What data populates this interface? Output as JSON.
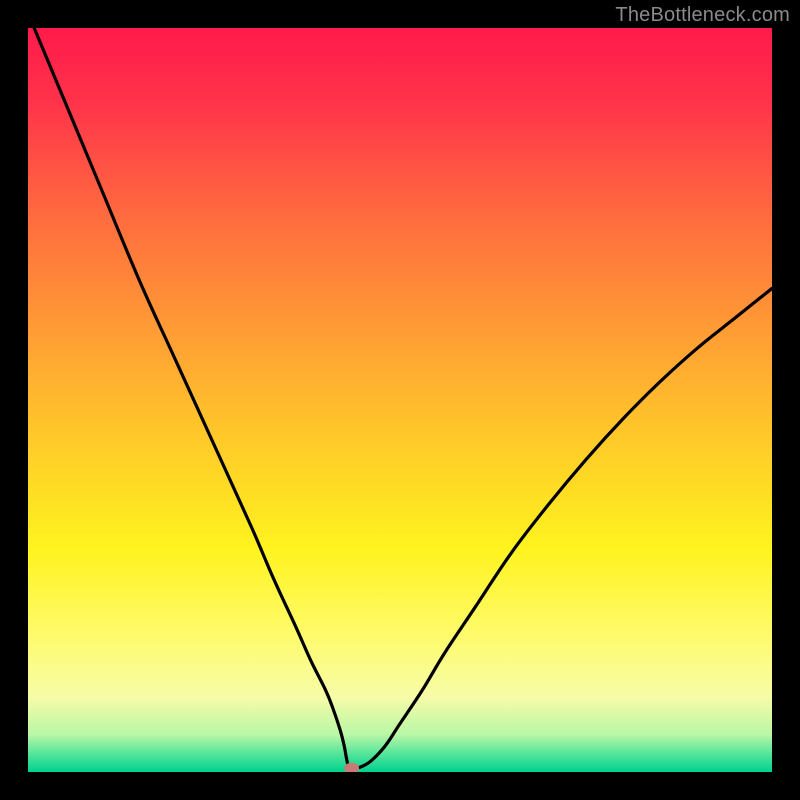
{
  "watermark": "TheBottleneck.com",
  "chart_data": {
    "type": "line",
    "title": "",
    "xlabel": "",
    "ylabel": "",
    "xlim": [
      0,
      100
    ],
    "ylim": [
      0,
      100
    ],
    "x": [
      0,
      5,
      10,
      15,
      20,
      25,
      30,
      33,
      36,
      38,
      40,
      41,
      42,
      42.5,
      43,
      43.5,
      44.5,
      46,
      48,
      50,
      53,
      56,
      60,
      65,
      70,
      75,
      80,
      85,
      90,
      95,
      100
    ],
    "values": [
      102,
      90,
      78,
      66,
      55,
      44,
      33,
      26,
      19.5,
      15,
      11,
      8.5,
      5.5,
      3.5,
      1,
      0.5,
      0.6,
      1.4,
      3.5,
      6.5,
      11,
      16,
      22,
      29.5,
      36,
      42,
      47.5,
      52.5,
      57,
      61,
      65
    ],
    "marker": {
      "x": 43.5,
      "y": 0.5
    },
    "gradient_stops": [
      {
        "offset": 0.0,
        "color": "#ff1a4b"
      },
      {
        "offset": 0.1,
        "color": "#ff334a"
      },
      {
        "offset": 0.25,
        "color": "#ff6a3f"
      },
      {
        "offset": 0.4,
        "color": "#ff9a35"
      },
      {
        "offset": 0.55,
        "color": "#ffc929"
      },
      {
        "offset": 0.7,
        "color": "#fff31f"
      },
      {
        "offset": 0.82,
        "color": "#fffb6e"
      },
      {
        "offset": 0.9,
        "color": "#f6fca8"
      },
      {
        "offset": 0.95,
        "color": "#b8f7a6"
      },
      {
        "offset": 0.975,
        "color": "#56e59a"
      },
      {
        "offset": 1.0,
        "color": "#00d18f"
      }
    ],
    "curve_color": "#000000",
    "marker_color": "#c77b74"
  }
}
